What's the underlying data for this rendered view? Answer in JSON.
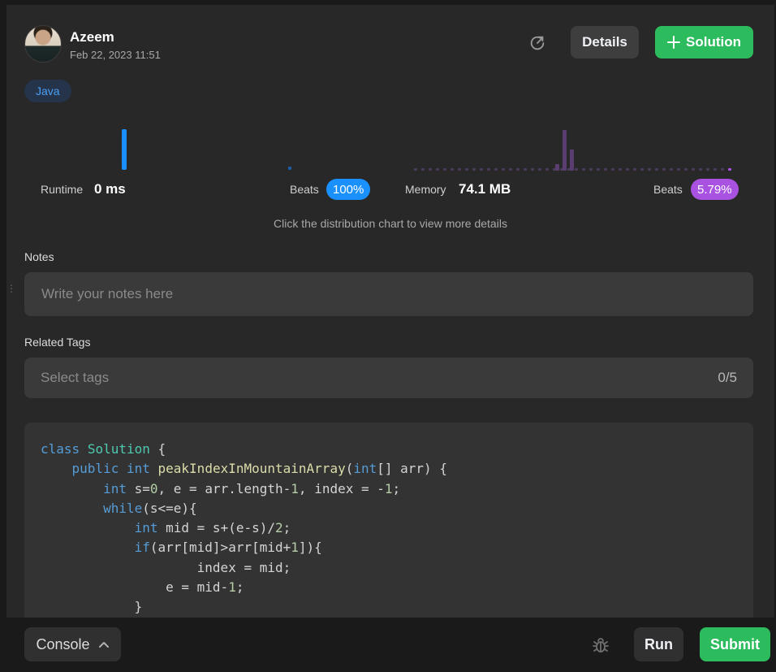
{
  "user": {
    "name": "Azeem",
    "date": "Feb 22, 2023 11:51"
  },
  "header": {
    "details_label": "Details",
    "solution_label": "Solution"
  },
  "language_tag": "Java",
  "runtime": {
    "label": "Runtime",
    "value": "0 ms",
    "beats_label": "Beats",
    "beats_pct": "100%",
    "color": "#1a90ff"
  },
  "memory": {
    "label": "Memory",
    "value": "74.1 MB",
    "beats_label": "Beats",
    "beats_pct": "5.79%",
    "color": "#a951e0"
  },
  "hint": "Click the distribution chart to view more details",
  "notes": {
    "label": "Notes",
    "placeholder": "Write your notes here"
  },
  "related_tags": {
    "label": "Related Tags",
    "placeholder": "Select tags",
    "count": "0/5"
  },
  "code_lines": [
    [
      [
        "kw",
        "class"
      ],
      [
        "op",
        " "
      ],
      [
        "ty",
        "Solution"
      ],
      [
        "op",
        " {"
      ]
    ],
    [
      [
        "op",
        "    "
      ],
      [
        "kw",
        "public"
      ],
      [
        "op",
        " "
      ],
      [
        "kw",
        "int"
      ],
      [
        "op",
        " "
      ],
      [
        "fn",
        "peakIndexInMountainArray"
      ],
      [
        "op",
        "("
      ],
      [
        "kw",
        "int"
      ],
      [
        "op",
        "[] arr) {"
      ]
    ],
    [
      [
        "op",
        "        "
      ],
      [
        "kw",
        "int"
      ],
      [
        "op",
        " s="
      ],
      [
        "nm",
        "0"
      ],
      [
        "op",
        ", e = arr.length-"
      ],
      [
        "nm",
        "1"
      ],
      [
        "op",
        ", index = -"
      ],
      [
        "nm",
        "1"
      ],
      [
        "op",
        ";"
      ]
    ],
    [
      [
        "op",
        "        "
      ],
      [
        "kw",
        "while"
      ],
      [
        "op",
        "(s<=e){"
      ]
    ],
    [
      [
        "op",
        "            "
      ],
      [
        "kw",
        "int"
      ],
      [
        "op",
        " mid = s+(e-s)/"
      ],
      [
        "nm",
        "2"
      ],
      [
        "op",
        ";"
      ]
    ],
    [
      [
        "op",
        "            "
      ],
      [
        "kw",
        "if"
      ],
      [
        "op",
        "(arr[mid]>arr[mid+"
      ],
      [
        "nm",
        "1"
      ],
      [
        "op",
        "]){"
      ]
    ],
    [
      [
        "op",
        "                    index = mid;"
      ]
    ],
    [
      [
        "op",
        "                e = mid-"
      ],
      [
        "nm",
        "1"
      ],
      [
        "op",
        ";"
      ]
    ],
    [
      [
        "op",
        "            }"
      ]
    ]
  ],
  "bottom": {
    "console_label": "Console",
    "run_label": "Run",
    "submit_label": "Submit"
  },
  "colors": {
    "accent_green": "#2cbb5d",
    "runtime_blue": "#1a90ff",
    "memory_purple": "#a951e0"
  }
}
